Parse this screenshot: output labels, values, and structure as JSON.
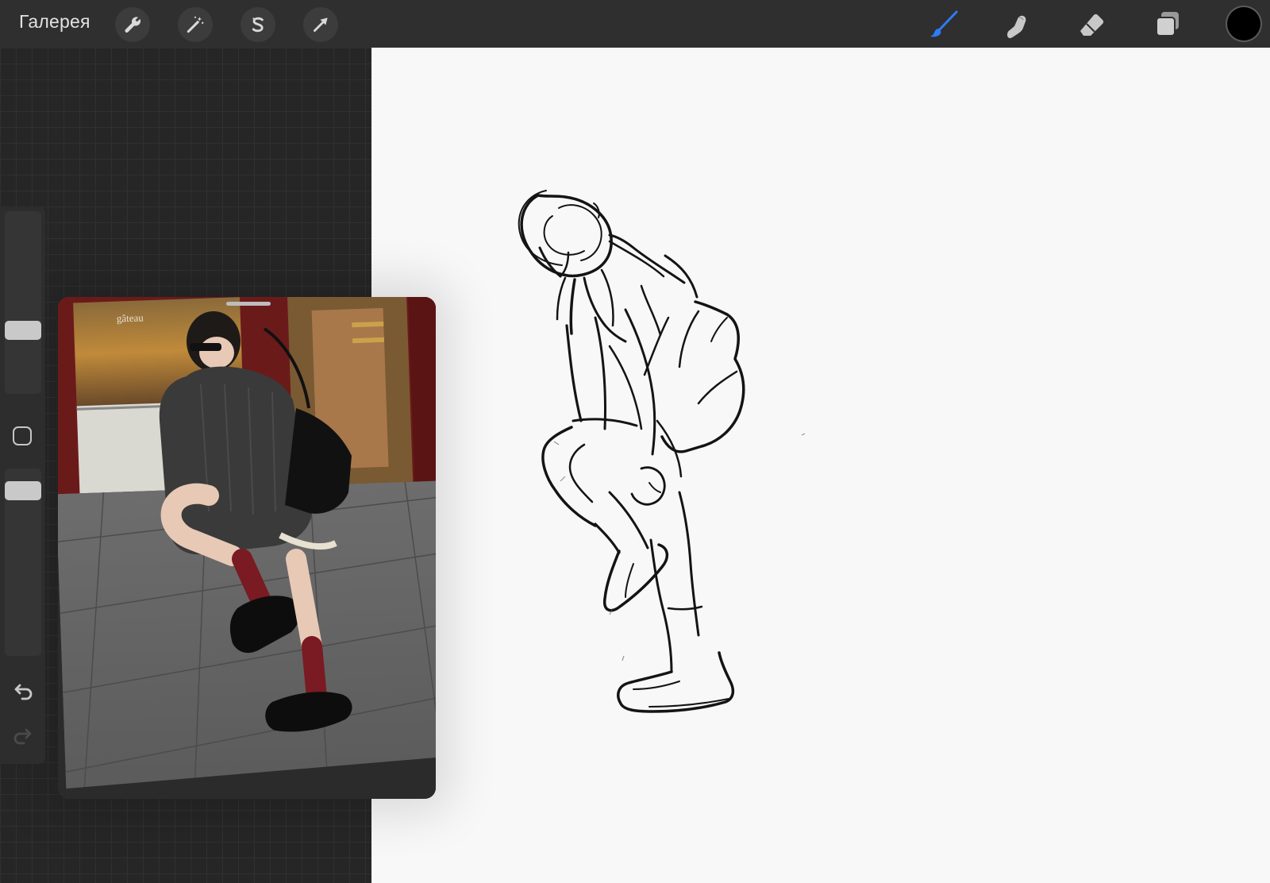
{
  "toolbar": {
    "gallery_label": "Галерея",
    "left_tools": [
      {
        "name": "actions",
        "icon": "wrench-icon"
      },
      {
        "name": "adjustments",
        "icon": "magic-wand-icon"
      },
      {
        "name": "selection",
        "icon": "selection-s-icon"
      },
      {
        "name": "transform",
        "icon": "arrow-cursor-icon"
      }
    ],
    "right_tools": [
      {
        "name": "brush",
        "icon": "brush-icon",
        "active": true
      },
      {
        "name": "smudge",
        "icon": "smudge-finger-icon",
        "active": false
      },
      {
        "name": "eraser",
        "icon": "eraser-icon",
        "active": false
      },
      {
        "name": "layers",
        "icon": "layers-icon",
        "active": false
      }
    ],
    "active_color": "#000000",
    "accent_color": "#2f7bf6"
  },
  "sidebar": {
    "brush_size": 0.62,
    "opacity": 1.0,
    "modify_icon": "square-icon",
    "undo_icon": "undo-arrow-icon",
    "redo_icon": "redo-arrow-icon"
  },
  "reference": {
    "subject": "reference-photo",
    "storefront_text": "gâteau"
  },
  "canvas": {
    "background": "#f8f8f8",
    "stroke_color": "#111111"
  }
}
